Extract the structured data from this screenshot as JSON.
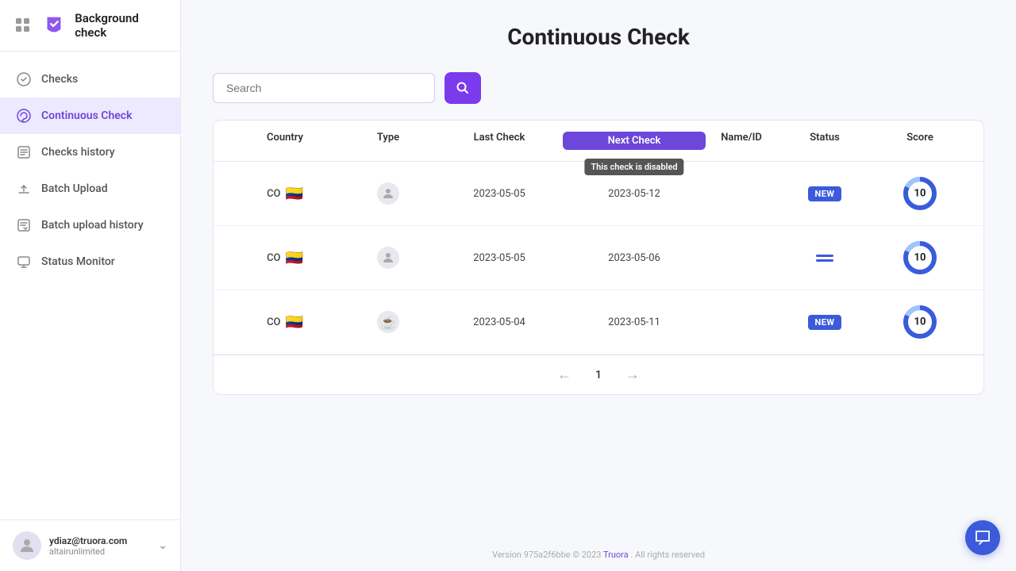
{
  "sidebar": {
    "logo_text": "Background check",
    "nav_items": [
      {
        "id": "checks",
        "label": "Checks",
        "active": false
      },
      {
        "id": "continuous-check",
        "label": "Continuous Check",
        "active": true
      },
      {
        "id": "checks-history",
        "label": "Checks history",
        "active": false
      },
      {
        "id": "batch-upload",
        "label": "Batch Upload",
        "active": false
      },
      {
        "id": "batch-upload-history",
        "label": "Batch upload history",
        "active": false
      },
      {
        "id": "status-monitor",
        "label": "Status Monitor",
        "active": false
      }
    ],
    "user": {
      "email": "ydiaz@truora.com",
      "company": "altairunlimited"
    }
  },
  "main": {
    "page_title": "Continuous Check",
    "search_placeholder": "Search",
    "table": {
      "columns": [
        "Country",
        "Type",
        "Last Check",
        "Next Check",
        "Name/ID",
        "Status",
        "Score"
      ],
      "next_check_tooltip": "This check is disabled",
      "rows": [
        {
          "country_code": "CO",
          "flag": "🇨🇴",
          "type": "person",
          "last_check": "2023-05-05",
          "next_check": "2023-05-12",
          "name_id": "",
          "status": "new",
          "score": 10
        },
        {
          "country_code": "CO",
          "flag": "🇨🇴",
          "type": "person",
          "last_check": "2023-05-05",
          "next_check": "2023-05-06",
          "name_id": "",
          "status": "lines",
          "score": 10
        },
        {
          "country_code": "CO",
          "flag": "🇨🇴",
          "type": "puzzle",
          "last_check": "2023-05-04",
          "next_check": "2023-05-11",
          "name_id": "",
          "status": "new",
          "score": 10
        }
      ],
      "pagination": {
        "current_page": 1
      }
    }
  },
  "footer": {
    "version_text": "Version 975a2f6bbe © 2023",
    "brand_link": "Truora",
    "rights_text": ". All rights reserved"
  },
  "labels": {
    "search_btn": "🔍",
    "prev_arrow": "←",
    "next_arrow": "→"
  }
}
